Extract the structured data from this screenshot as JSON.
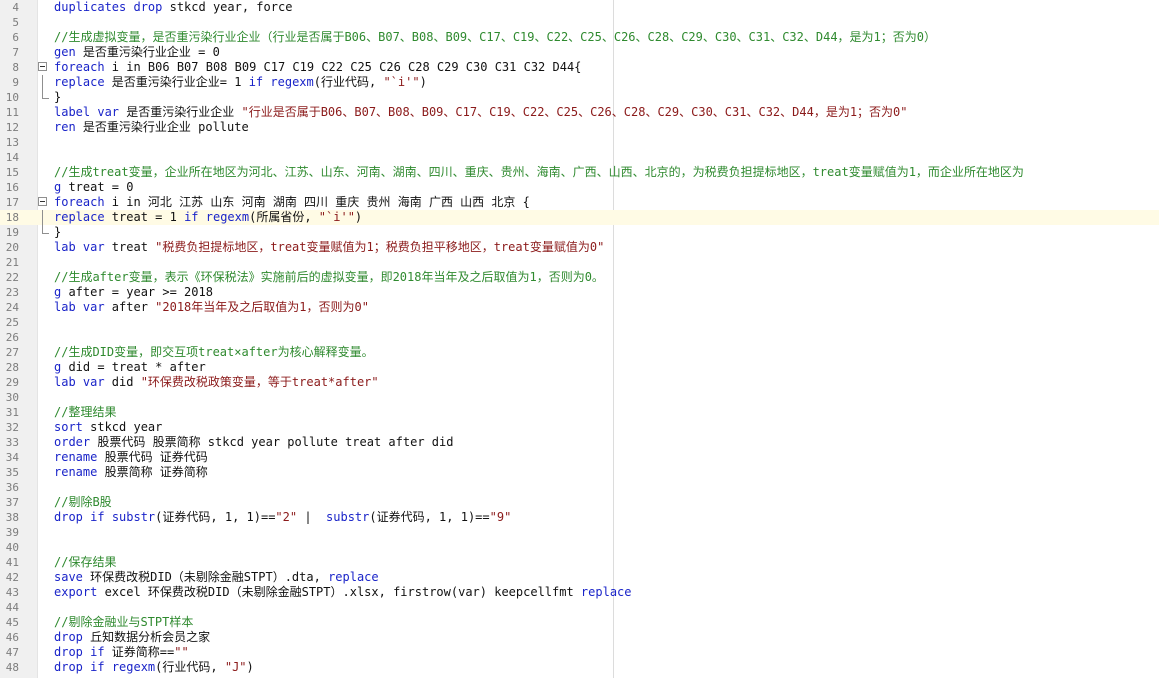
{
  "editor": {
    "highlight_line": "18",
    "lines": [
      {
        "n": "4",
        "tokens": [
          {
            "t": "kw",
            "v": "duplicates drop"
          },
          {
            "t": "tx",
            "v": " stkcd year, force"
          }
        ]
      },
      {
        "n": "5",
        "tokens": []
      },
      {
        "n": "6",
        "tokens": [
          {
            "t": "cm",
            "v": "//生成虚拟变量，是否重污染行业企业（行业是否属于B06、B07、B08、B09、C17、C19、C22、C25、C26、C28、C29、C30、C31、C32、D44，是为1；否为0）"
          }
        ]
      },
      {
        "n": "7",
        "tokens": [
          {
            "t": "kw",
            "v": "gen"
          },
          {
            "t": "tx",
            "v": " 是否重污染行业企业 = 0"
          }
        ]
      },
      {
        "n": "8",
        "fold": "start",
        "tokens": [
          {
            "t": "kw",
            "v": "foreach"
          },
          {
            "t": "tx",
            "v": " i in B06 B07 B08 B09 C17 C19 C22 C25 C26 C28 C29 C30 C31 C32 D44{"
          }
        ]
      },
      {
        "n": "9",
        "fold": "mid",
        "tokens": [
          {
            "t": "kw",
            "v": "replace"
          },
          {
            "t": "tx",
            "v": " 是否重污染行业企业= 1 "
          },
          {
            "t": "kw",
            "v": "if"
          },
          {
            "t": "tx",
            "v": " "
          },
          {
            "t": "kw",
            "v": "regexm"
          },
          {
            "t": "tx",
            "v": "(行业代码, "
          },
          {
            "t": "str",
            "v": "\"`i'\""
          },
          {
            "t": "tx",
            "v": ")"
          }
        ]
      },
      {
        "n": "10",
        "fold": "end",
        "tokens": [
          {
            "t": "tx",
            "v": "}"
          }
        ]
      },
      {
        "n": "11",
        "tokens": [
          {
            "t": "kw",
            "v": "label var"
          },
          {
            "t": "tx",
            "v": " 是否重污染行业企业 "
          },
          {
            "t": "str",
            "v": "\"行业是否属于B06、B07、B08、B09、C17、C19、C22、C25、C26、C28、C29、C30、C31、C32、D44，是为1；否为0\""
          }
        ]
      },
      {
        "n": "12",
        "tokens": [
          {
            "t": "kw",
            "v": "ren"
          },
          {
            "t": "tx",
            "v": " 是否重污染行业企业 pollute"
          }
        ]
      },
      {
        "n": "13",
        "tokens": []
      },
      {
        "n": "14",
        "tokens": []
      },
      {
        "n": "15",
        "tokens": [
          {
            "t": "cm",
            "v": "//生成treat变量，企业所在地区为河北、江苏、山东、河南、湖南、四川、重庆、贵州、海南、广西、山西、北京的，为税费负担提标地区，treat变量赋值为1，而企业所在地区为"
          }
        ]
      },
      {
        "n": "16",
        "tokens": [
          {
            "t": "kw",
            "v": "g"
          },
          {
            "t": "tx",
            "v": " treat = 0"
          }
        ]
      },
      {
        "n": "17",
        "fold": "start",
        "tokens": [
          {
            "t": "kw",
            "v": "foreach"
          },
          {
            "t": "tx",
            "v": " i in 河北 江苏 山东 河南 湖南 四川 重庆 贵州 海南 广西 山西 北京 {"
          }
        ]
      },
      {
        "n": "18",
        "fold": "mid",
        "tokens": [
          {
            "t": "kw",
            "v": "replace"
          },
          {
            "t": "tx",
            "v": " treat = 1 "
          },
          {
            "t": "kw",
            "v": "if"
          },
          {
            "t": "tx",
            "v": " "
          },
          {
            "t": "kw",
            "v": "regexm"
          },
          {
            "t": "tx",
            "v": "(所属省份, "
          },
          {
            "t": "str",
            "v": "\"`i'\""
          },
          {
            "t": "tx",
            "v": ")"
          }
        ]
      },
      {
        "n": "19",
        "fold": "end",
        "tokens": [
          {
            "t": "tx",
            "v": "}"
          }
        ]
      },
      {
        "n": "20",
        "tokens": [
          {
            "t": "kw",
            "v": "lab var"
          },
          {
            "t": "tx",
            "v": " treat "
          },
          {
            "t": "str",
            "v": "\"税费负担提标地区，treat变量赋值为1；税费负担平移地区，treat变量赋值为0\""
          }
        ]
      },
      {
        "n": "21",
        "tokens": []
      },
      {
        "n": "22",
        "tokens": [
          {
            "t": "cm",
            "v": "//生成after变量，表示《环保税法》实施前后的虚拟变量，即2018年当年及之后取值为1，否则为0。"
          }
        ]
      },
      {
        "n": "23",
        "tokens": [
          {
            "t": "kw",
            "v": "g"
          },
          {
            "t": "tx",
            "v": " after = year >= 2018"
          }
        ]
      },
      {
        "n": "24",
        "tokens": [
          {
            "t": "kw",
            "v": "lab var"
          },
          {
            "t": "tx",
            "v": " after "
          },
          {
            "t": "str",
            "v": "\"2018年当年及之后取值为1，否则为0\""
          }
        ]
      },
      {
        "n": "25",
        "tokens": []
      },
      {
        "n": "26",
        "tokens": []
      },
      {
        "n": "27",
        "tokens": [
          {
            "t": "cm",
            "v": "//生成DID变量，即交互项treat×after为核心解释变量。"
          }
        ]
      },
      {
        "n": "28",
        "tokens": [
          {
            "t": "kw",
            "v": "g"
          },
          {
            "t": "tx",
            "v": " did = treat * after"
          }
        ]
      },
      {
        "n": "29",
        "tokens": [
          {
            "t": "kw",
            "v": "lab var"
          },
          {
            "t": "tx",
            "v": " did "
          },
          {
            "t": "str",
            "v": "\"环保费改税政策变量，等于treat*after\""
          }
        ]
      },
      {
        "n": "30",
        "tokens": []
      },
      {
        "n": "31",
        "tokens": [
          {
            "t": "cm",
            "v": "//整理结果"
          }
        ]
      },
      {
        "n": "32",
        "tokens": [
          {
            "t": "kw",
            "v": "sort"
          },
          {
            "t": "tx",
            "v": " stkcd year"
          }
        ]
      },
      {
        "n": "33",
        "tokens": [
          {
            "t": "kw",
            "v": "order"
          },
          {
            "t": "tx",
            "v": " 股票代码 股票简称 stkcd year pollute treat after did"
          }
        ]
      },
      {
        "n": "34",
        "tokens": [
          {
            "t": "kw",
            "v": "rename"
          },
          {
            "t": "tx",
            "v": " 股票代码 证券代码"
          }
        ]
      },
      {
        "n": "35",
        "tokens": [
          {
            "t": "kw",
            "v": "rename"
          },
          {
            "t": "tx",
            "v": " 股票简称 证券简称"
          }
        ]
      },
      {
        "n": "36",
        "tokens": []
      },
      {
        "n": "37",
        "tokens": [
          {
            "t": "cm",
            "v": "//剔除B股"
          }
        ]
      },
      {
        "n": "38",
        "tokens": [
          {
            "t": "kw",
            "v": "drop if"
          },
          {
            "t": "tx",
            "v": " "
          },
          {
            "t": "kw",
            "v": "substr"
          },
          {
            "t": "tx",
            "v": "(证券代码, 1, 1)=="
          },
          {
            "t": "str",
            "v": "\"2\""
          },
          {
            "t": "tx",
            "v": " |  "
          },
          {
            "t": "kw",
            "v": "substr"
          },
          {
            "t": "tx",
            "v": "(证券代码, 1, 1)=="
          },
          {
            "t": "str",
            "v": "\"9\""
          }
        ]
      },
      {
        "n": "39",
        "tokens": []
      },
      {
        "n": "40",
        "tokens": []
      },
      {
        "n": "41",
        "tokens": [
          {
            "t": "cm",
            "v": "//保存结果"
          }
        ]
      },
      {
        "n": "42",
        "tokens": [
          {
            "t": "kw",
            "v": "save"
          },
          {
            "t": "tx",
            "v": " 环保费改税DID（未剔除金融STPT）.dta, "
          },
          {
            "t": "kw",
            "v": "replace"
          }
        ]
      },
      {
        "n": "43",
        "tokens": [
          {
            "t": "kw",
            "v": "export"
          },
          {
            "t": "tx",
            "v": " excel 环保费改税DID（未剔除金融STPT）.xlsx, firstrow(var) keepcellfmt "
          },
          {
            "t": "kw",
            "v": "replace"
          }
        ]
      },
      {
        "n": "44",
        "tokens": []
      },
      {
        "n": "45",
        "tokens": [
          {
            "t": "cm",
            "v": "//剔除金融业与STPT样本"
          }
        ]
      },
      {
        "n": "46",
        "tokens": [
          {
            "t": "kw",
            "v": "drop"
          },
          {
            "t": "tx",
            "v": " 丘知数据分析会员之家"
          }
        ]
      },
      {
        "n": "47",
        "tokens": [
          {
            "t": "kw",
            "v": "drop if"
          },
          {
            "t": "tx",
            "v": " 证券简称=="
          },
          {
            "t": "str",
            "v": "\"\""
          }
        ]
      },
      {
        "n": "48",
        "tokens": [
          {
            "t": "kw",
            "v": "drop if"
          },
          {
            "t": "tx",
            "v": " "
          },
          {
            "t": "kw",
            "v": "regexm"
          },
          {
            "t": "tx",
            "v": "(行业代码, "
          },
          {
            "t": "str",
            "v": "\"J\""
          },
          {
            "t": "tx",
            "v": ")"
          }
        ]
      }
    ]
  }
}
